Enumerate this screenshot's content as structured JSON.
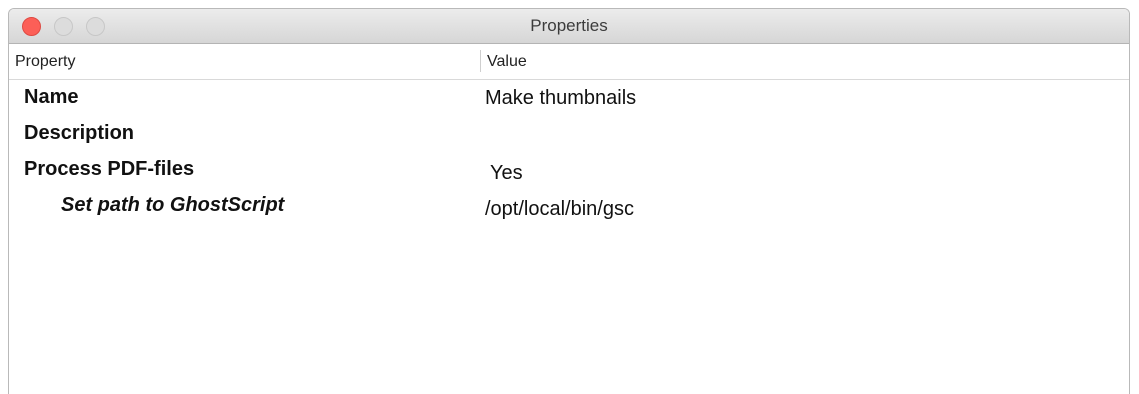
{
  "window": {
    "title": "Properties"
  },
  "columns": {
    "property": "Property",
    "value": "Value"
  },
  "rows": [
    {
      "label": "Name",
      "value": "Make thumbnails",
      "level": 0
    },
    {
      "label": "Description",
      "value": "",
      "level": 0
    },
    {
      "label": "Process PDF-files",
      "value": "Yes",
      "level": 0
    },
    {
      "label": "Set path to GhostScript",
      "value": "/opt/local/bin/gsc",
      "level": 1
    }
  ],
  "colors": {
    "close_button": "#fc5f57",
    "inactive_button": "#dcdcdc"
  }
}
